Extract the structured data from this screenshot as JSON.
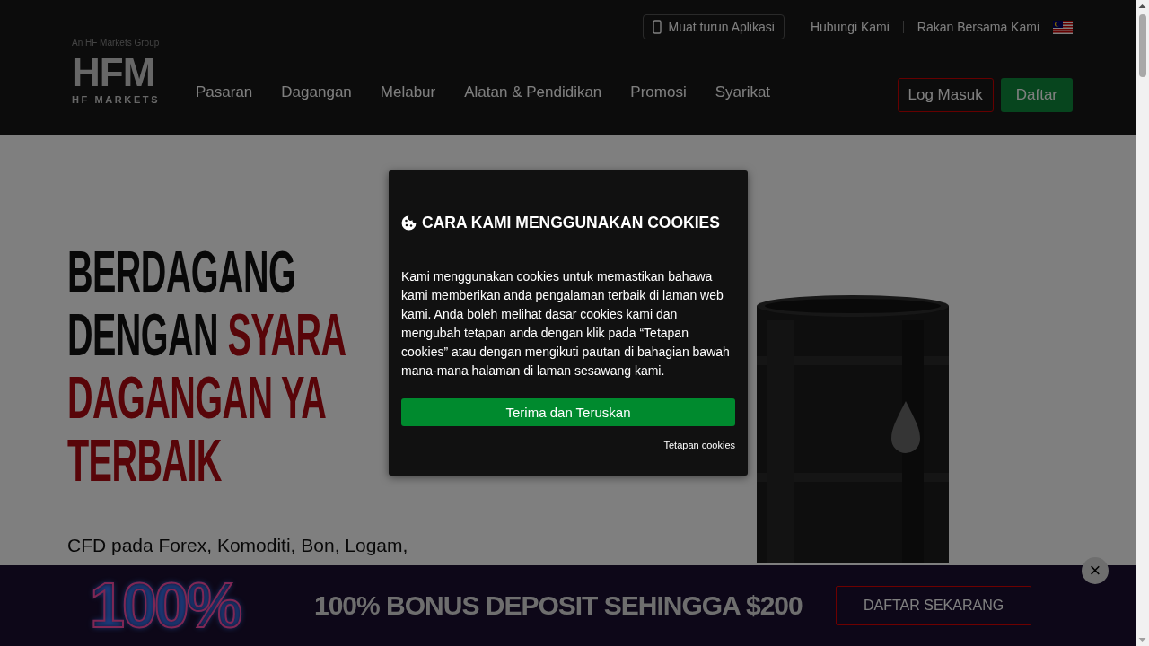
{
  "header": {
    "logo": {
      "group": "An HF Markets Group",
      "mark": "HFM",
      "name": "HF MARKETS"
    },
    "app_button": "Muat turun Aplikasi",
    "links": [
      "Hubungi Kami",
      "Rakan Bersama Kami"
    ],
    "nav": [
      "Pasaran",
      "Dagangan",
      "Melabur",
      "Alatan & Pendidikan",
      "Promosi",
      "Syarikat"
    ],
    "login_button": "Log Masuk",
    "signup_button": "Daftar"
  },
  "hero": {
    "title_lines": [
      [
        {
          "text": "BERDAGANG",
          "accent": false
        }
      ],
      [
        {
          "text": "DENGAN ",
          "accent": false
        },
        {
          "text": "SYARA",
          "accent": true
        }
      ],
      [
        {
          "text": "DAGANGAN YA",
          "accent": true
        }
      ],
      [
        {
          "text": "TERBAIK",
          "accent": true
        }
      ]
    ],
    "subtitle": "CFD pada Forex, Komoditi, Bon, Logam,"
  },
  "cookie_dialog": {
    "title": "CARA KAMI MENGGUNAKAN COOKIES",
    "body": "Kami menggunakan cookies untuk memastikan bahawa kami memberikan anda pengalaman terbaik di laman web kami. Anda boleh melihat dasar cookies kami dan mengubah tetapan anda dengan klik pada “Tetapan cookies” atau dengan mengikuti pautan di bahagian bawah mana-mana halaman di laman sesawang kami.",
    "accept_button": "Terima dan Teruskan",
    "settings_link": "Tetapan cookies"
  },
  "promo_banner": {
    "badge": "100%",
    "text": "100% BONUS DEPOSIT SEHINGGA $200",
    "button": "DAFTAR SEKARANG",
    "close": "×"
  }
}
